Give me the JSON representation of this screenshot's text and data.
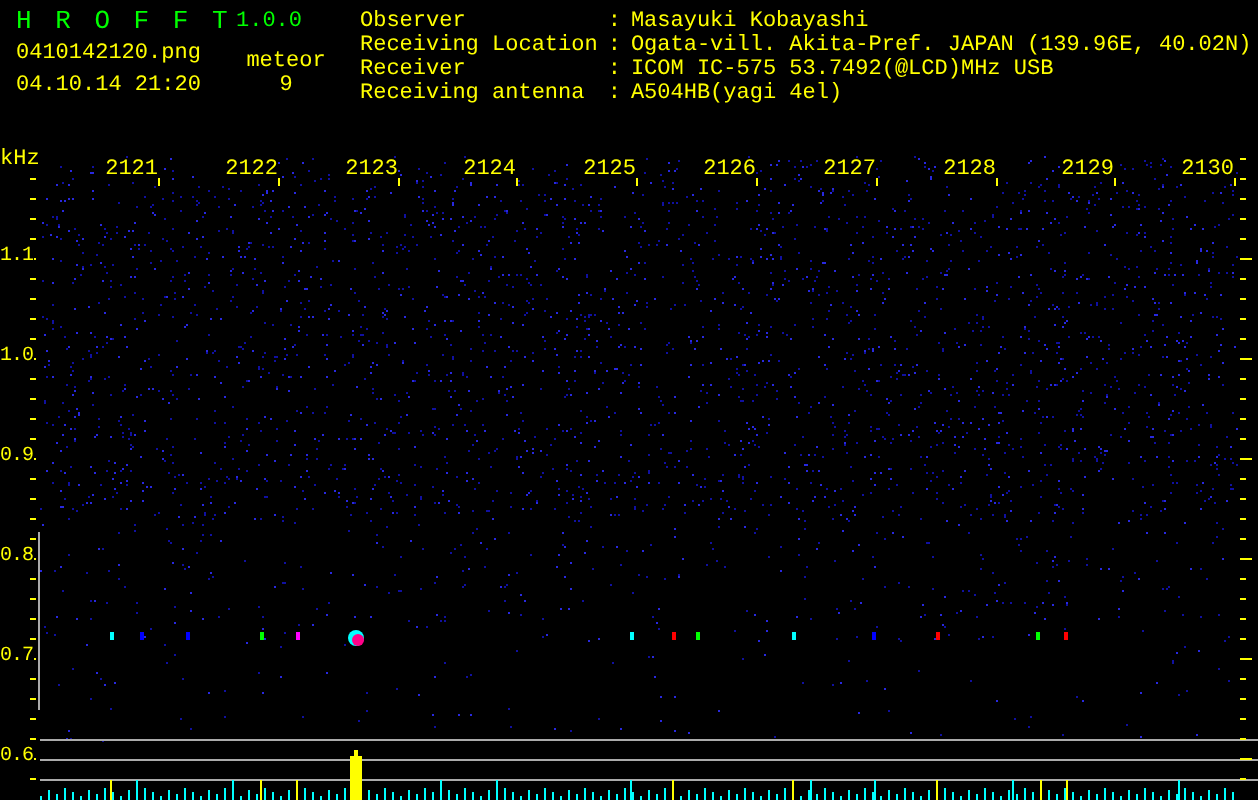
{
  "header": {
    "app_name": "H R O F F T",
    "version": "1.0.0",
    "filename": "0410142120.png",
    "datetime": "04.10.14 21:20",
    "meteor_label": "meteor",
    "meteor_count": "9"
  },
  "info": [
    {
      "label": "Observer",
      "separator": ":",
      "value": "Masayuki Kobayashi"
    },
    {
      "label": "Receiving Location",
      "separator": ":",
      "value": "Ogata-vill. Akita-Pref. JAPAN (139.96E, 40.02N)"
    },
    {
      "label": "Receiver",
      "separator": ":",
      "value": "ICOM IC-575 53.7492(@LCD)MHz USB"
    },
    {
      "label": "Receiving antenna",
      "separator": ":",
      "value": "A504HB(yagi 4el)"
    }
  ],
  "plot": {
    "y_unit": "kHz",
    "x_labels": [
      "2121",
      "2122",
      "2123",
      "2124",
      "2125",
      "2126",
      "2127",
      "2128",
      "2129",
      "2130"
    ],
    "y_labels": [
      "1.1",
      "1.0",
      "0.9",
      "0.8",
      "0.7",
      "0.6"
    ]
  }
}
